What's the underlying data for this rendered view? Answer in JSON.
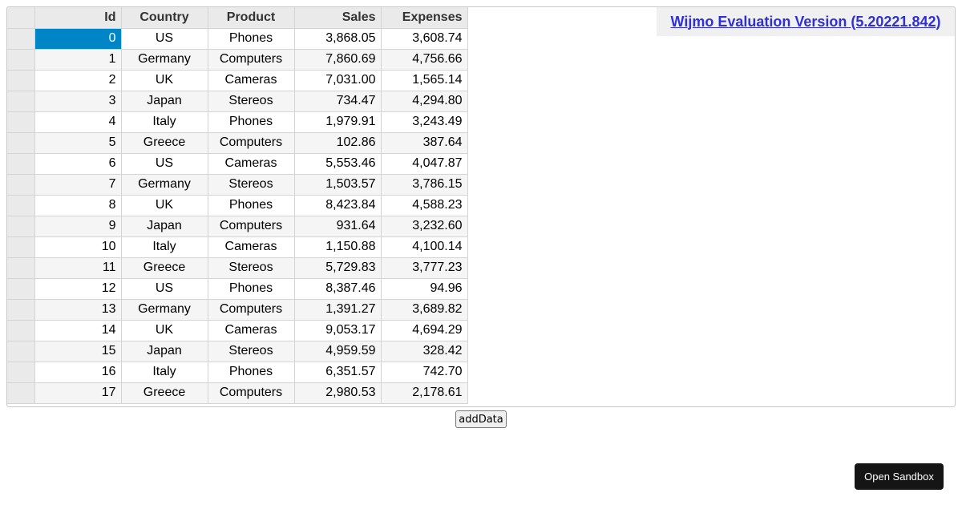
{
  "grid": {
    "columns": [
      "Id",
      "Country",
      "Product",
      "Sales",
      "Expenses"
    ],
    "rows": [
      {
        "id": "0",
        "country": "US",
        "product": "Phones",
        "sales": "3,868.05",
        "expenses": "3,608.74"
      },
      {
        "id": "1",
        "country": "Germany",
        "product": "Computers",
        "sales": "7,860.69",
        "expenses": "4,756.66"
      },
      {
        "id": "2",
        "country": "UK",
        "product": "Cameras",
        "sales": "7,031.00",
        "expenses": "1,565.14"
      },
      {
        "id": "3",
        "country": "Japan",
        "product": "Stereos",
        "sales": "734.47",
        "expenses": "4,294.80"
      },
      {
        "id": "4",
        "country": "Italy",
        "product": "Phones",
        "sales": "1,979.91",
        "expenses": "3,243.49"
      },
      {
        "id": "5",
        "country": "Greece",
        "product": "Computers",
        "sales": "102.86",
        "expenses": "387.64"
      },
      {
        "id": "6",
        "country": "US",
        "product": "Cameras",
        "sales": "5,553.46",
        "expenses": "4,047.87"
      },
      {
        "id": "7",
        "country": "Germany",
        "product": "Stereos",
        "sales": "1,503.57",
        "expenses": "3,786.15"
      },
      {
        "id": "8",
        "country": "UK",
        "product": "Phones",
        "sales": "8,423.84",
        "expenses": "4,588.23"
      },
      {
        "id": "9",
        "country": "Japan",
        "product": "Computers",
        "sales": "931.64",
        "expenses": "3,232.60"
      },
      {
        "id": "10",
        "country": "Italy",
        "product": "Cameras",
        "sales": "1,150.88",
        "expenses": "4,100.14"
      },
      {
        "id": "11",
        "country": "Greece",
        "product": "Stereos",
        "sales": "5,729.83",
        "expenses": "3,777.23"
      },
      {
        "id": "12",
        "country": "US",
        "product": "Phones",
        "sales": "8,387.46",
        "expenses": "94.96"
      },
      {
        "id": "13",
        "country": "Germany",
        "product": "Computers",
        "sales": "1,391.27",
        "expenses": "3,689.82"
      },
      {
        "id": "14",
        "country": "UK",
        "product": "Cameras",
        "sales": "9,053.17",
        "expenses": "4,694.29"
      },
      {
        "id": "15",
        "country": "Japan",
        "product": "Stereos",
        "sales": "4,959.59",
        "expenses": "328.42"
      },
      {
        "id": "16",
        "country": "Italy",
        "product": "Phones",
        "sales": "6,351.57",
        "expenses": "742.70"
      },
      {
        "id": "17",
        "country": "Greece",
        "product": "Computers",
        "sales": "2,980.53",
        "expenses": "2,178.61"
      }
    ]
  },
  "banner": {
    "text": "Wijmo Evaluation Version (5.20221.842)"
  },
  "buttons": {
    "add_data": "addData",
    "open_sandbox": "Open Sandbox"
  },
  "colors": {
    "selection": "#0085c7",
    "header_bg": "#eaeaea",
    "banner_link": "#2f2fd8",
    "sandbox_bg": "#151515"
  }
}
